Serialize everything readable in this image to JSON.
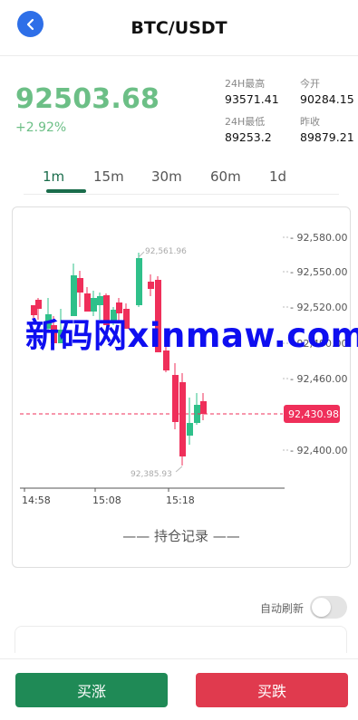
{
  "header": {
    "title": "BTC/USDT"
  },
  "ticker": {
    "price": "92503.68",
    "change": "+2.92%",
    "high_label": "24H最高",
    "high_value": "93571.41",
    "open_label": "今开",
    "open_value": "90284.15",
    "low_label": "24H最低",
    "low_value": "89253.2",
    "prev_label": "昨收",
    "prev_value": "89879.21"
  },
  "tabs": [
    "1m",
    "15m",
    "30m",
    "60m",
    "1d"
  ],
  "active_tab": "1m",
  "chart_data": {
    "type": "candlestick",
    "y_ticks": [
      "92,580.00",
      "92,550.00",
      "92,520.00",
      "92,490.00",
      "92,460.00",
      "92,400.00"
    ],
    "x_ticks": [
      "14:58",
      "15:08",
      "15:18"
    ],
    "current_price_label": "92,430.98",
    "high_marker": "92,561.96",
    "low_marker": "92,385.93",
    "colors": {
      "up": "#2fc08a",
      "down": "#ef2f5a",
      "current_line": "#ef2f5a"
    }
  },
  "position_title": "—— 持仓记录 ——",
  "auto_refresh_label": "自动刷新",
  "buttons": {
    "buy": "买涨",
    "sell": "买跌"
  },
  "watermark": "新码网xinmaw.com"
}
